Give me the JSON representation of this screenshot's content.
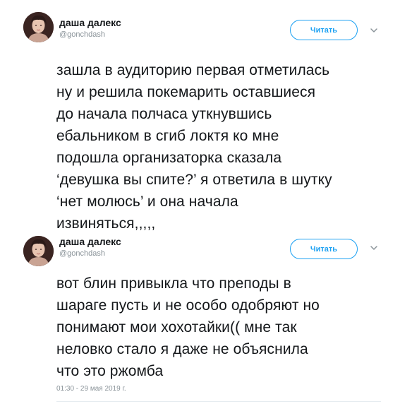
{
  "tweets": [
    {
      "author_name": "даша далекс",
      "handle": "@gonchdash",
      "follow_label": "Читать",
      "text": "зашла в аудиторию первая отметилась\nну и решила покемарить оставшиеся\nдо начала полчаса уткнувшись\nебальником в сгиб локтя ко  мне\nподошла организаторка сказала\n‘девушка вы спите?’ я ответила в шутку\n‘нет молюсь’ и она начала\nизвиняться,,,,,"
    },
    {
      "author_name": "даша далекс",
      "handle": "@gonchdash",
      "follow_label": "Читать",
      "text": "вот блин привыкла что преподы в\nшараге пусть и не особо одобряют но\nпонимают мои хохотайки(( мне так\nнеловко стало я даже не объяснила\nчто это ржомба",
      "timestamp": "01:30 - 29 мая 2019 г."
    }
  ],
  "icons": {
    "menu": "chevron-down-icon",
    "avatar": "avatar"
  },
  "colors": {
    "accent": "#1da1f2",
    "text": "#14171a",
    "muted": "#8a9399",
    "divider": "#e6ecf0"
  }
}
